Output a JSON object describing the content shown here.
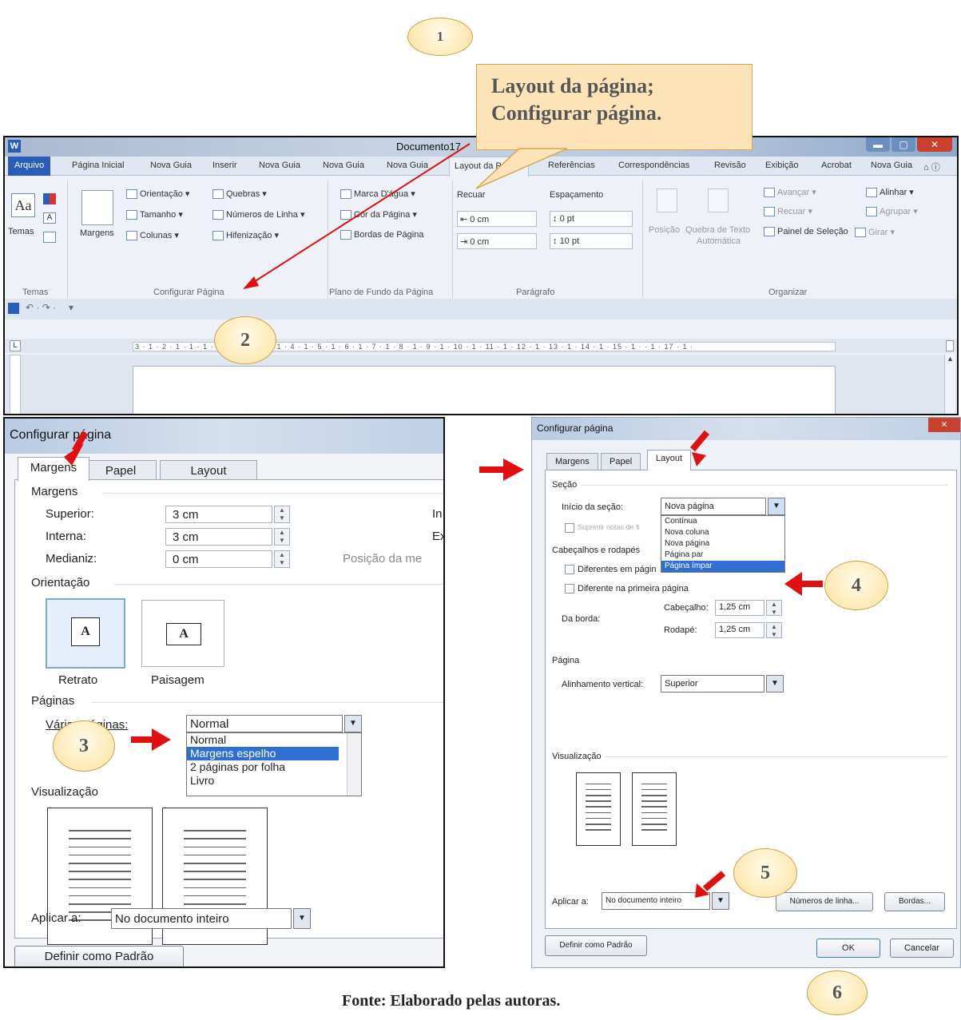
{
  "badges": [
    "1",
    "2",
    "3",
    "4",
    "5",
    "6"
  ],
  "callout": {
    "line1": "Layout da página;",
    "line2": "Configurar página."
  },
  "word": {
    "title": "Documento17",
    "tabs": [
      "Arquivo",
      "Página Inicial",
      "Nova Guia",
      "Inserir",
      "Nova Guia",
      "Nova Guia",
      "Nova Guia",
      "Layout da Página",
      "Referências",
      "Correspondências",
      "Revisão",
      "Exibição",
      "Acrobat",
      "Nova Guia"
    ],
    "temas": {
      "label": "Temas",
      "group": "Temas"
    },
    "config": {
      "margens": "Margens",
      "orientacao": "Orientação",
      "tamanho": "Tamanho",
      "colunas": "Colunas",
      "quebras": "Quebras",
      "numeros_linha": "Números de Linha",
      "hifenizacao": "Hifenização",
      "group": "Configurar Página"
    },
    "fundo": {
      "marca": "Marca D'água",
      "cor": "Cor da Página",
      "bordas": "Bordas de Página",
      "group": "Plano de Fundo da Página"
    },
    "paragrafo": {
      "recuar": "Recuar",
      "espacamento": "Espaçamento",
      "recuo_esq": "0 cm",
      "recuo_dir": "0 cm",
      "esp_antes": "0 pt",
      "esp_depois": "10 pt",
      "group": "Parágrafo"
    },
    "organizar": {
      "posicao": "Posição",
      "quebra_texto": "Quebra de Texto",
      "automatica": "Automática",
      "avancar": "Avançar",
      "recuar": "Recuar",
      "painel": "Painel de Seleção",
      "alinhar": "Alinhar",
      "agrupar": "Agrupar",
      "girar": "Girar",
      "group": "Organizar"
    },
    "ruler": "3 · 1 · 2 · 1 · 1 · 1 ·   · 1 · 2 · 1 · 3 · 1 · 4 · 1 · 5 · 1 · 6 · 1 · 7 · 1 · 8 · 1 · 9 · 1 · 10 · 1 · 11 · 1 · 12 · 1 · 13 · 1 · 14 · 1 · 15 · 1 ·   · 1 · 17 · 1 ·"
  },
  "dialog1": {
    "title": "Configurar página",
    "tabs": [
      "Margens",
      "Papel",
      "Layout"
    ],
    "margens_section": "Margens",
    "superior_label": "Superior:",
    "superior_value": "3 cm",
    "interna_label": "Interna:",
    "interna_value": "3 cm",
    "medianiz_label": "Medianiz:",
    "medianiz_value": "0 cm",
    "right_clip1": "In",
    "right_clip2": "Ex",
    "posicao_clip": "Posição da me",
    "orientacao_section": "Orientação",
    "retrato": "Retrato",
    "paisagem": "Paisagem",
    "paginas_section": "Páginas",
    "varias_label": "Várias páginas:",
    "varias_value": "Normal",
    "varias_options": [
      "Normal",
      "Margens espelho",
      "2 páginas por folha",
      "Livro"
    ],
    "visualizacao_clip": "Visualização",
    "aplicar_label": "Aplicar a:",
    "aplicar_value": "No documento inteiro",
    "padrao_button": "Definir como Padrão"
  },
  "dialog2": {
    "title": "Configurar página",
    "tabs": [
      "Margens",
      "Papel",
      "Layout"
    ],
    "secao_section": "Seção",
    "inicio_label": "Início da seção:",
    "inicio_value": "Nova página",
    "inicio_options": [
      "Contínua",
      "Nova coluna",
      "Nova página",
      "Página par",
      "Página ímpar"
    ],
    "suprimir_label": "Suprimir notas de fi",
    "cabecalhos_section": "Cabeçalhos e rodapés",
    "diferentes_label": "Diferentes em págin",
    "primeira_label": "Diferente na primeira página",
    "da_borda_label": "Da borda:",
    "cabecalho_label": "Cabeçalho:",
    "cabecalho_value": "1,25 cm",
    "rodape_label": "Rodapé:",
    "rodape_value": "1,25 cm",
    "pagina_section": "Página",
    "alinhamento_label": "Alinhamento vertical:",
    "alinhamento_value": "Superior",
    "visualizacao_section": "Visualização",
    "aplicar_label": "Aplicar a:",
    "aplicar_value": "No documento inteiro",
    "numeros_button": "Números de linha...",
    "bordas_button": "Bordas...",
    "padrao_button": "Definir como Padrão",
    "ok_button": "OK",
    "cancelar_button": "Cancelar"
  },
  "footer": "Fonte: Elaborado pelas autoras.",
  "colors": {
    "arrow": "#e01010",
    "badge_fill": "#fde9b3",
    "callout_fill": "#fce4b8",
    "file_tab": "#2a5db5",
    "highlight": "#2f6fd1"
  }
}
